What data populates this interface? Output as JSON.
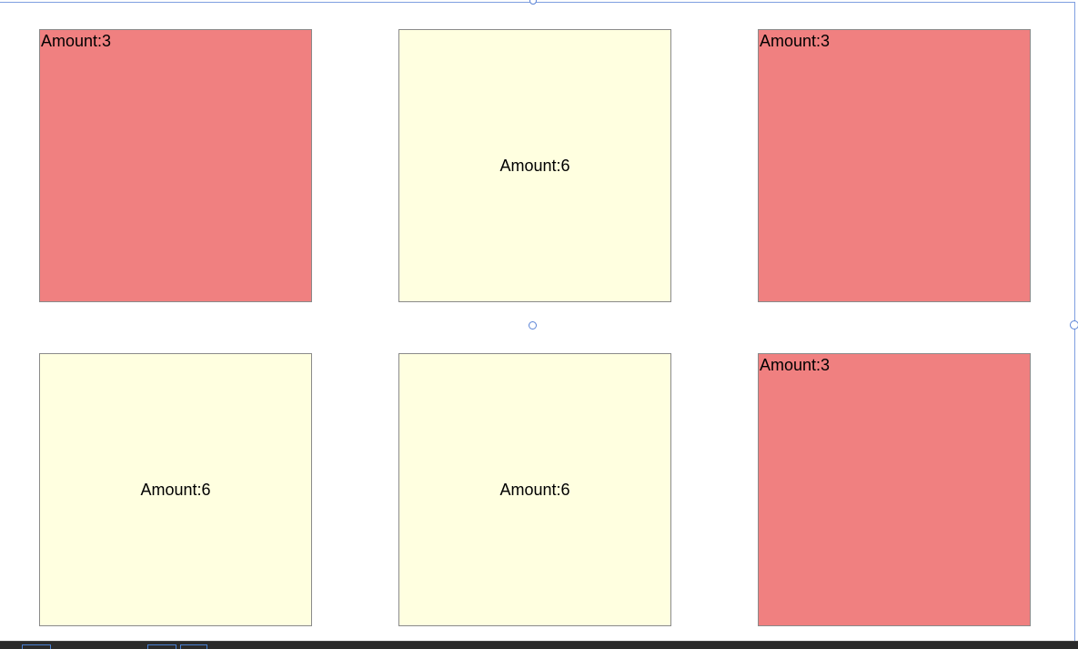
{
  "tiles": [
    {
      "label": "Amount:3",
      "state": "low",
      "color": "#f08080"
    },
    {
      "label": "Amount:6",
      "state": "high",
      "color": "#ffffe0"
    },
    {
      "label": "Amount:3",
      "state": "low",
      "color": "#f08080"
    },
    {
      "label": "Amount:6",
      "state": "high",
      "color": "#ffffe0"
    },
    {
      "label": "Amount:6",
      "state": "high",
      "color": "#ffffe0"
    },
    {
      "label": "Amount:3",
      "state": "low",
      "color": "#f08080"
    }
  ],
  "colors": {
    "low_tile": "#f08080",
    "high_tile": "#ffffe0",
    "tile_border": "#8a8a8a",
    "selection_guide": "#7f9fe0"
  },
  "icons": {
    "selection_handle": "selection-handle-icon"
  }
}
